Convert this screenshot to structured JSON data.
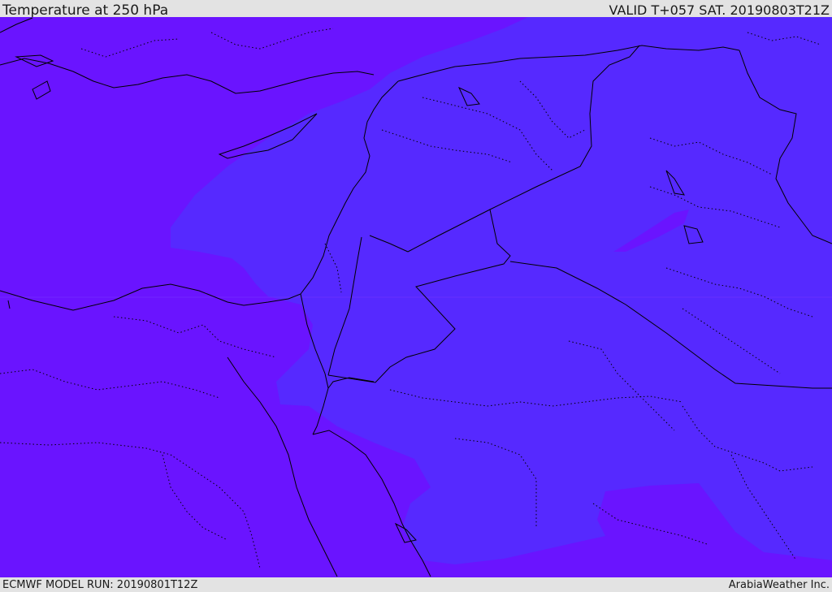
{
  "header": {
    "title": "Temperature at 250 hPa",
    "valid": "VALID T+057 SAT. 20190803T21Z"
  },
  "footer": {
    "model_run": "ECMWF MODEL RUN: 20190801T12Z",
    "credit": "ArabiaWeather Inc."
  },
  "map": {
    "field": "temperature",
    "level": "250 hPa",
    "colors": {
      "cold_fill": "#6a14ff",
      "warm_fill": "#5629ff",
      "coastline": "#000000",
      "border": "#000000"
    }
  }
}
